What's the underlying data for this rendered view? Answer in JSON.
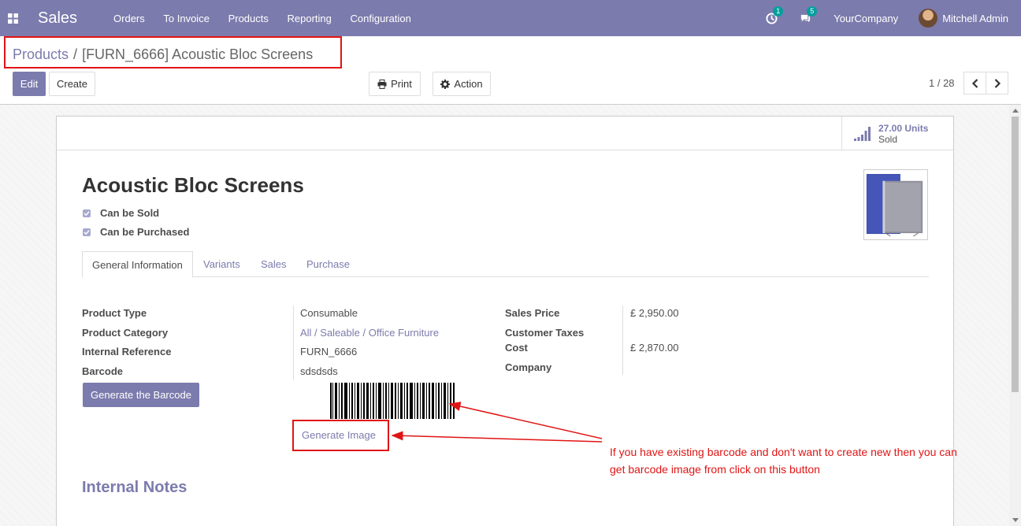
{
  "navbar": {
    "app_name": "Sales",
    "menu": [
      "Orders",
      "To Invoice",
      "Products",
      "Reporting",
      "Configuration"
    ],
    "activity_count": "1",
    "message_count": "5",
    "company": "YourCompany",
    "user": "Mitchell Admin",
    "bg_color": "#7c7bad"
  },
  "breadcrumb": {
    "parent": "Products",
    "separator": "/",
    "current": "[FURN_6666] Acoustic Bloc Screens"
  },
  "toolbar": {
    "edit_label": "Edit",
    "create_label": "Create",
    "print_label": "Print",
    "action_label": "Action",
    "pager": "1 / 28"
  },
  "stat_button": {
    "value": "27.00 Units",
    "label": "Sold"
  },
  "product": {
    "name": "Acoustic Bloc Screens",
    "can_be_sold_label": "Can be Sold",
    "can_be_sold": true,
    "can_be_purchased_label": "Can be Purchased",
    "can_be_purchased": true
  },
  "tabs": [
    {
      "label": "General Information",
      "active": true
    },
    {
      "label": "Variants",
      "active": false
    },
    {
      "label": "Sales",
      "active": false
    },
    {
      "label": "Purchase",
      "active": false
    }
  ],
  "fields_left": [
    {
      "label": "Product Type",
      "value": "Consumable"
    },
    {
      "label": "Product Category",
      "value": "All / Saleable / Office Furniture"
    },
    {
      "label": "Internal Reference",
      "value": "FURN_6666"
    },
    {
      "label": "Barcode",
      "value": "sdsdsds"
    }
  ],
  "fields_right": [
    {
      "label": "Sales Price",
      "value": "£ 2,950.00"
    },
    {
      "label": "Customer Taxes",
      "value": ""
    },
    {
      "label": "Cost",
      "value": "£ 2,870.00"
    },
    {
      "label": "Company",
      "value": ""
    }
  ],
  "generate_barcode_label": "Generate the Barcode",
  "generate_image_label": "Generate Image",
  "internal_notes_title": "Internal Notes",
  "annotation": {
    "text": "If you have existing barcode and don't want to create new then you can get barcode image from click on this button",
    "color": "#e01414"
  },
  "accent_color": "#7c7bad"
}
